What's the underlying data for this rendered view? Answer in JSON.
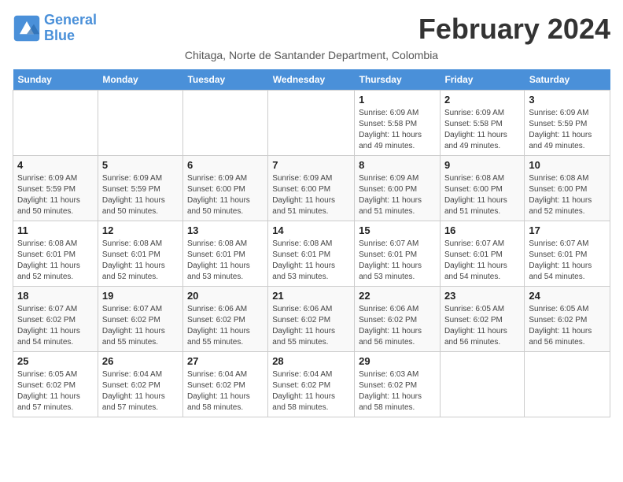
{
  "app": {
    "logo_line1": "General",
    "logo_line2": "Blue"
  },
  "header": {
    "title": "February 2024",
    "subtitle": "Chitaga, Norte de Santander Department, Colombia"
  },
  "weekdays": [
    "Sunday",
    "Monday",
    "Tuesday",
    "Wednesday",
    "Thursday",
    "Friday",
    "Saturday"
  ],
  "weeks": [
    [
      {
        "num": "",
        "info": ""
      },
      {
        "num": "",
        "info": ""
      },
      {
        "num": "",
        "info": ""
      },
      {
        "num": "",
        "info": ""
      },
      {
        "num": "1",
        "info": "Sunrise: 6:09 AM\nSunset: 5:58 PM\nDaylight: 11 hours\nand 49 minutes."
      },
      {
        "num": "2",
        "info": "Sunrise: 6:09 AM\nSunset: 5:58 PM\nDaylight: 11 hours\nand 49 minutes."
      },
      {
        "num": "3",
        "info": "Sunrise: 6:09 AM\nSunset: 5:59 PM\nDaylight: 11 hours\nand 49 minutes."
      }
    ],
    [
      {
        "num": "4",
        "info": "Sunrise: 6:09 AM\nSunset: 5:59 PM\nDaylight: 11 hours\nand 50 minutes."
      },
      {
        "num": "5",
        "info": "Sunrise: 6:09 AM\nSunset: 5:59 PM\nDaylight: 11 hours\nand 50 minutes."
      },
      {
        "num": "6",
        "info": "Sunrise: 6:09 AM\nSunset: 6:00 PM\nDaylight: 11 hours\nand 50 minutes."
      },
      {
        "num": "7",
        "info": "Sunrise: 6:09 AM\nSunset: 6:00 PM\nDaylight: 11 hours\nand 51 minutes."
      },
      {
        "num": "8",
        "info": "Sunrise: 6:09 AM\nSunset: 6:00 PM\nDaylight: 11 hours\nand 51 minutes."
      },
      {
        "num": "9",
        "info": "Sunrise: 6:08 AM\nSunset: 6:00 PM\nDaylight: 11 hours\nand 51 minutes."
      },
      {
        "num": "10",
        "info": "Sunrise: 6:08 AM\nSunset: 6:00 PM\nDaylight: 11 hours\nand 52 minutes."
      }
    ],
    [
      {
        "num": "11",
        "info": "Sunrise: 6:08 AM\nSunset: 6:01 PM\nDaylight: 11 hours\nand 52 minutes."
      },
      {
        "num": "12",
        "info": "Sunrise: 6:08 AM\nSunset: 6:01 PM\nDaylight: 11 hours\nand 52 minutes."
      },
      {
        "num": "13",
        "info": "Sunrise: 6:08 AM\nSunset: 6:01 PM\nDaylight: 11 hours\nand 53 minutes."
      },
      {
        "num": "14",
        "info": "Sunrise: 6:08 AM\nSunset: 6:01 PM\nDaylight: 11 hours\nand 53 minutes."
      },
      {
        "num": "15",
        "info": "Sunrise: 6:07 AM\nSunset: 6:01 PM\nDaylight: 11 hours\nand 53 minutes."
      },
      {
        "num": "16",
        "info": "Sunrise: 6:07 AM\nSunset: 6:01 PM\nDaylight: 11 hours\nand 54 minutes."
      },
      {
        "num": "17",
        "info": "Sunrise: 6:07 AM\nSunset: 6:01 PM\nDaylight: 11 hours\nand 54 minutes."
      }
    ],
    [
      {
        "num": "18",
        "info": "Sunrise: 6:07 AM\nSunset: 6:02 PM\nDaylight: 11 hours\nand 54 minutes."
      },
      {
        "num": "19",
        "info": "Sunrise: 6:07 AM\nSunset: 6:02 PM\nDaylight: 11 hours\nand 55 minutes."
      },
      {
        "num": "20",
        "info": "Sunrise: 6:06 AM\nSunset: 6:02 PM\nDaylight: 11 hours\nand 55 minutes."
      },
      {
        "num": "21",
        "info": "Sunrise: 6:06 AM\nSunset: 6:02 PM\nDaylight: 11 hours\nand 55 minutes."
      },
      {
        "num": "22",
        "info": "Sunrise: 6:06 AM\nSunset: 6:02 PM\nDaylight: 11 hours\nand 56 minutes."
      },
      {
        "num": "23",
        "info": "Sunrise: 6:05 AM\nSunset: 6:02 PM\nDaylight: 11 hours\nand 56 minutes."
      },
      {
        "num": "24",
        "info": "Sunrise: 6:05 AM\nSunset: 6:02 PM\nDaylight: 11 hours\nand 56 minutes."
      }
    ],
    [
      {
        "num": "25",
        "info": "Sunrise: 6:05 AM\nSunset: 6:02 PM\nDaylight: 11 hours\nand 57 minutes."
      },
      {
        "num": "26",
        "info": "Sunrise: 6:04 AM\nSunset: 6:02 PM\nDaylight: 11 hours\nand 57 minutes."
      },
      {
        "num": "27",
        "info": "Sunrise: 6:04 AM\nSunset: 6:02 PM\nDaylight: 11 hours\nand 58 minutes."
      },
      {
        "num": "28",
        "info": "Sunrise: 6:04 AM\nSunset: 6:02 PM\nDaylight: 11 hours\nand 58 minutes."
      },
      {
        "num": "29",
        "info": "Sunrise: 6:03 AM\nSunset: 6:02 PM\nDaylight: 11 hours\nand 58 minutes."
      },
      {
        "num": "",
        "info": ""
      },
      {
        "num": "",
        "info": ""
      }
    ]
  ]
}
